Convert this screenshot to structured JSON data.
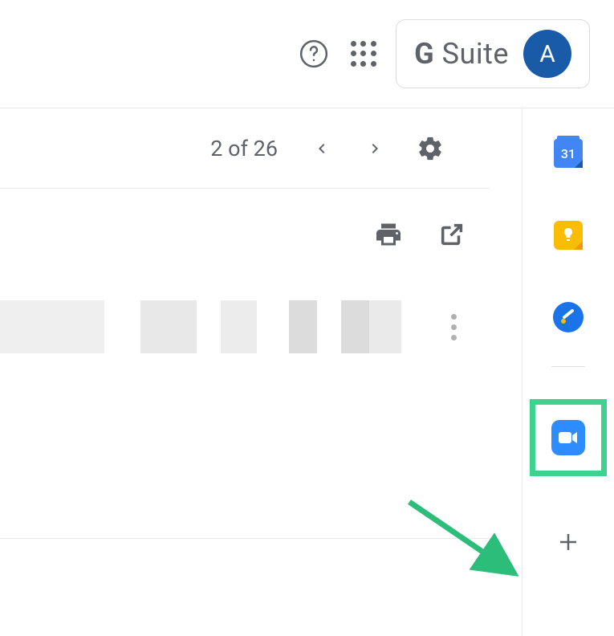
{
  "header": {
    "suite_label_prefix": "G ",
    "suite_label_rest": "Suite",
    "avatar_initial": "A"
  },
  "toolbar": {
    "pager_text": "2 of 26"
  },
  "side_rail": {
    "calendar_day": "31"
  }
}
